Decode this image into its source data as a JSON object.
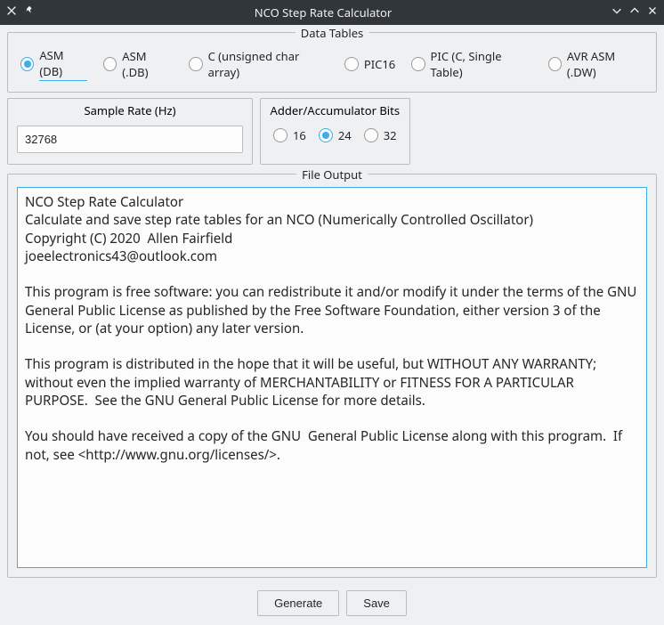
{
  "window": {
    "title": "NCO Step Rate Calculator"
  },
  "dataTables": {
    "legend": "Data Tables",
    "options": [
      "ASM (DB)",
      "ASM (.DB)",
      "C (unsigned char array)",
      "PIC16",
      "PIC (C, Single Table)",
      "AVR ASM (.DW)"
    ],
    "selected": 0
  },
  "sampleRate": {
    "legend": "Sample Rate (Hz)",
    "value": "32768"
  },
  "bits": {
    "legend": "Adder/Accumulator Bits",
    "options": [
      "16",
      "24",
      "32"
    ],
    "selected": 1
  },
  "fileOutput": {
    "legend": "File Output",
    "text": "NCO Step Rate Calculator\nCalculate and save step rate tables for an NCO (Numerically Controlled Oscillator)\nCopyright (C) 2020  Allen Fairfield\njoeelectronics43@outlook.com\n\nThis program is free software: you can redistribute it and/or modify it under the terms of the GNU General Public License as published by the Free Software Foundation, either version 3 of the License, or (at your option) any later version.\n\nThis program is distributed in the hope that it will be useful, but WITHOUT ANY WARRANTY; without even the implied warranty of MERCHANTABILITY or FITNESS FOR A PARTICULAR PURPOSE.  See the GNU General Public License for more details.\n\nYou should have received a copy of the GNU  General Public License along with this program.  If not, see <http://www.gnu.org/licenses/>."
  },
  "buttons": {
    "generate": "Generate",
    "save": "Save"
  }
}
